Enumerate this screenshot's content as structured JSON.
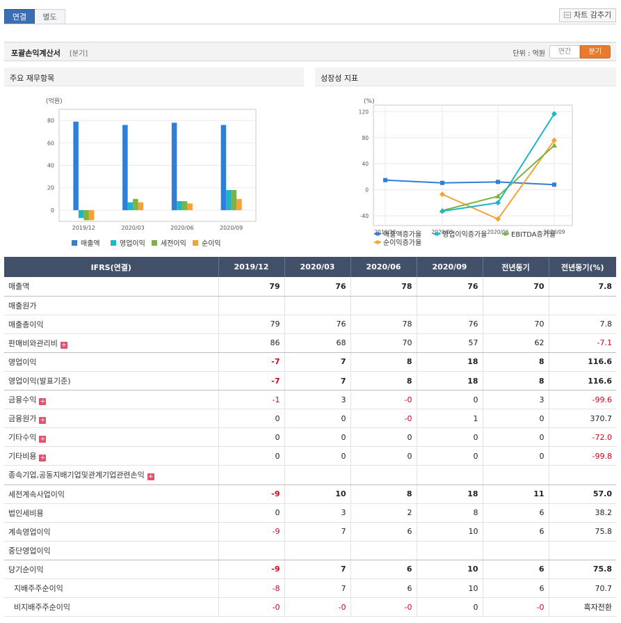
{
  "tabs": {
    "consolidated": "연결",
    "separate": "별도"
  },
  "chart_toggle_label": "차트 감추기",
  "section": {
    "title": "포괄손익계산서",
    "subtitle": "[분기]",
    "unit": "단위 : 억원",
    "period_year": "연간",
    "period_quarter": "분기"
  },
  "panels": {
    "left_title": "주요 재무항목",
    "right_title": "성장성 지표"
  },
  "colors": {
    "sales": "#2f7ed8",
    "operating": "#1fb5c9",
    "pretax": "#7cb342",
    "net": "#f7a234",
    "neg": "#d0021b"
  },
  "chart_data": [
    {
      "type": "bar",
      "ylabel": "(억원)",
      "ylim": [
        -10,
        90
      ],
      "yticks": [
        "80",
        "60",
        "40",
        "20",
        "0"
      ],
      "categories": [
        "2019/12",
        "2020/03",
        "2020/06",
        "2020/09"
      ],
      "series": [
        {
          "name": "매출액",
          "values": [
            79,
            76,
            78,
            76
          ]
        },
        {
          "name": "영업이익",
          "values": [
            -7,
            7,
            8,
            18
          ]
        },
        {
          "name": "세전이익",
          "values": [
            -9,
            10,
            8,
            18
          ]
        },
        {
          "name": "순이익",
          "values": [
            -9,
            7,
            6,
            10
          ]
        }
      ],
      "legend": "bottom"
    },
    {
      "type": "line",
      "ylabel": "(%)",
      "ylim": [
        -55,
        130
      ],
      "yticks": [
        "120",
        "80",
        "40",
        "0",
        "-40"
      ],
      "categories": [
        "2019/12",
        "2020/03",
        "2020/06",
        "2020/09"
      ],
      "series": [
        {
          "name": "매출액증가율",
          "values": [
            14.8,
            10.5,
            12.0,
            7.8
          ]
        },
        {
          "name": "영업이익증가율",
          "values": [
            null,
            -33.0,
            -20.0,
            116.6
          ]
        },
        {
          "name": "EBITDA증가율",
          "values": [
            null,
            -32.0,
            -10.0,
            68.0
          ]
        },
        {
          "name": "순이익증가율",
          "values": [
            null,
            -7.0,
            -45.0,
            75.8
          ]
        }
      ],
      "legend": "bottom"
    }
  ],
  "table": {
    "headers": [
      "IFRS(연결)",
      "2019/12",
      "2020/03",
      "2020/06",
      "2020/09",
      "전년동기",
      "전년동기(%)"
    ],
    "rows": [
      {
        "label": "매출액",
        "values": [
          "79",
          "76",
          "78",
          "76",
          "70",
          "7.8"
        ],
        "bold": true,
        "plus": false,
        "sub": false,
        "sep": true
      },
      {
        "label": "매출원가",
        "values": [
          "",
          "",
          "",
          "",
          "",
          ""
        ],
        "bold": false,
        "plus": false,
        "sub": false,
        "sep": false
      },
      {
        "label": "매출총이익",
        "values": [
          "79",
          "76",
          "78",
          "76",
          "70",
          "7.8"
        ],
        "bold": false,
        "plus": false,
        "sub": false,
        "sep": false
      },
      {
        "label": "판매비와관리비",
        "values": [
          "86",
          "68",
          "70",
          "57",
          "62",
          "-7.1"
        ],
        "bold": false,
        "plus": true,
        "sub": false,
        "sep": true
      },
      {
        "label": "영업이익",
        "values": [
          "-7",
          "7",
          "8",
          "18",
          "8",
          "116.6"
        ],
        "bold": true,
        "plus": false,
        "sub": false,
        "sep": false
      },
      {
        "label": "영업이익(발표기준)",
        "values": [
          "-7",
          "7",
          "8",
          "18",
          "8",
          "116.6"
        ],
        "bold": true,
        "plus": false,
        "sub": false,
        "sep": true
      },
      {
        "label": "금융수익",
        "values": [
          "-1",
          "3",
          "-0",
          "0",
          "3",
          "-99.6"
        ],
        "bold": false,
        "plus": true,
        "sub": false,
        "sep": false
      },
      {
        "label": "금융원가",
        "values": [
          "0",
          "0",
          "-0",
          "1",
          "0",
          "370.7"
        ],
        "bold": false,
        "plus": true,
        "sub": false,
        "sep": false
      },
      {
        "label": "기타수익",
        "values": [
          "0",
          "0",
          "0",
          "0",
          "0",
          "-72.0"
        ],
        "bold": false,
        "plus": true,
        "sub": false,
        "sep": false
      },
      {
        "label": "기타비용",
        "values": [
          "0",
          "0",
          "0",
          "0",
          "0",
          "-99.8"
        ],
        "bold": false,
        "plus": true,
        "sub": false,
        "sep": false
      },
      {
        "label": "종속기업,공동지배기업및관계기업관련손익",
        "values": [
          "",
          "",
          "",
          "",
          "",
          ""
        ],
        "bold": false,
        "plus": true,
        "sub": false,
        "sep": true
      },
      {
        "label": "세전계속사업이익",
        "values": [
          "-9",
          "10",
          "8",
          "18",
          "11",
          "57.0"
        ],
        "bold": true,
        "plus": false,
        "sub": false,
        "sep": false
      },
      {
        "label": "법인세비용",
        "values": [
          "0",
          "3",
          "2",
          "8",
          "6",
          "38.2"
        ],
        "bold": false,
        "plus": false,
        "sub": false,
        "sep": false
      },
      {
        "label": "계속영업이익",
        "values": [
          "-9",
          "7",
          "6",
          "10",
          "6",
          "75.8"
        ],
        "bold": false,
        "plus": false,
        "sub": false,
        "sep": false
      },
      {
        "label": "중단영업이익",
        "values": [
          "",
          "",
          "",
          "",
          "",
          ""
        ],
        "bold": false,
        "plus": false,
        "sub": false,
        "sep": true
      },
      {
        "label": "당기순이익",
        "values": [
          "-9",
          "7",
          "6",
          "10",
          "6",
          "75.8"
        ],
        "bold": true,
        "plus": false,
        "sub": false,
        "sep": false
      },
      {
        "label": "지배주주순이익",
        "values": [
          "-8",
          "7",
          "6",
          "10",
          "6",
          "70.7"
        ],
        "bold": false,
        "plus": false,
        "sub": true,
        "sep": false
      },
      {
        "label": "비지배주주순이익",
        "values": [
          "-0",
          "-0",
          "-0",
          "0",
          "-0",
          "흑자전환"
        ],
        "bold": false,
        "plus": false,
        "sub": true,
        "sep": false
      }
    ]
  }
}
